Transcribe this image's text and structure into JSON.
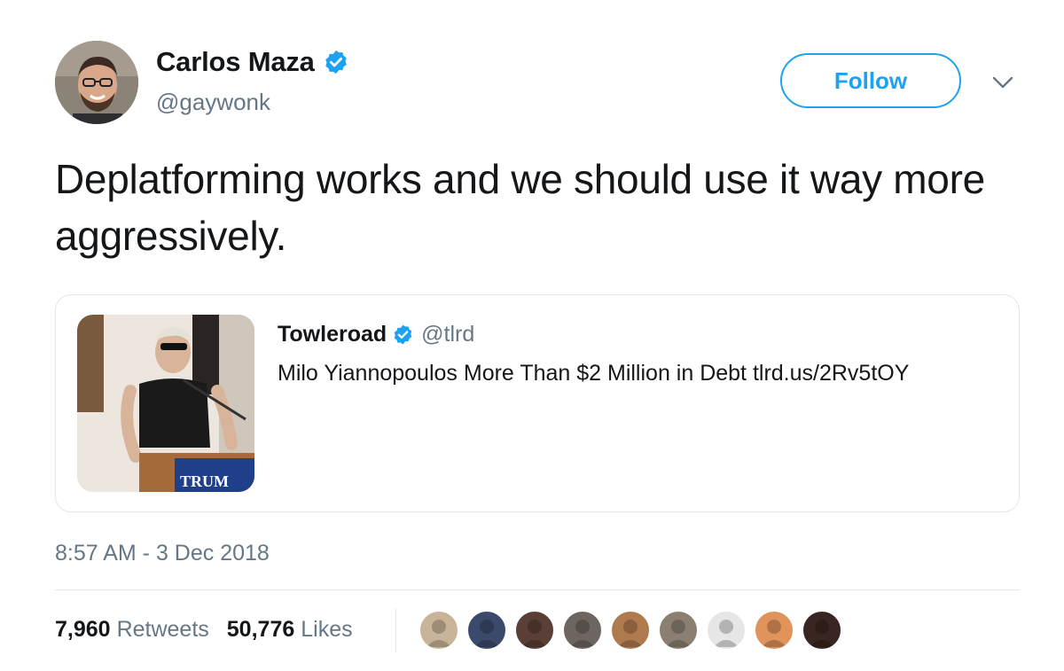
{
  "author": {
    "name": "Carlos Maza",
    "handle": "@gaywonk",
    "verified": true
  },
  "follow_button": {
    "label": "Follow"
  },
  "tweet": {
    "text": "Deplatforming works and we should use it way more aggressively."
  },
  "quoted_tweet": {
    "name": "Towleroad",
    "handle": "@tlrd",
    "verified": true,
    "text": "Milo Yiannopoulos More Than $2 Million in Debt tlrd.us/2Rv5tOY",
    "thumbnail_sign_text": "TRUM"
  },
  "timestamp": "8:57 AM - 3 Dec 2018",
  "stats": {
    "retweets_count": "7,960",
    "retweets_label": "Retweets",
    "likes_count": "50,776",
    "likes_label": "Likes"
  },
  "liker_avatars": [
    {
      "name": "liker-avatar-1",
      "color": "#c9b49a"
    },
    {
      "name": "liker-avatar-2",
      "color": "#3b4a6b"
    },
    {
      "name": "liker-avatar-3",
      "color": "#5a3f36"
    },
    {
      "name": "liker-avatar-4",
      "color": "#6e6460"
    },
    {
      "name": "liker-avatar-5",
      "color": "#b07a4f"
    },
    {
      "name": "liker-avatar-6",
      "color": "#8a7f70"
    },
    {
      "name": "liker-avatar-7",
      "color": "#e6e6e6"
    },
    {
      "name": "liker-avatar-8",
      "color": "#e0935a"
    },
    {
      "name": "liker-avatar-9",
      "color": "#3a2620"
    }
  ],
  "colors": {
    "accent": "#1da1f2",
    "text_primary": "#14171a",
    "text_secondary": "#657786",
    "border": "#e1e8ed"
  }
}
